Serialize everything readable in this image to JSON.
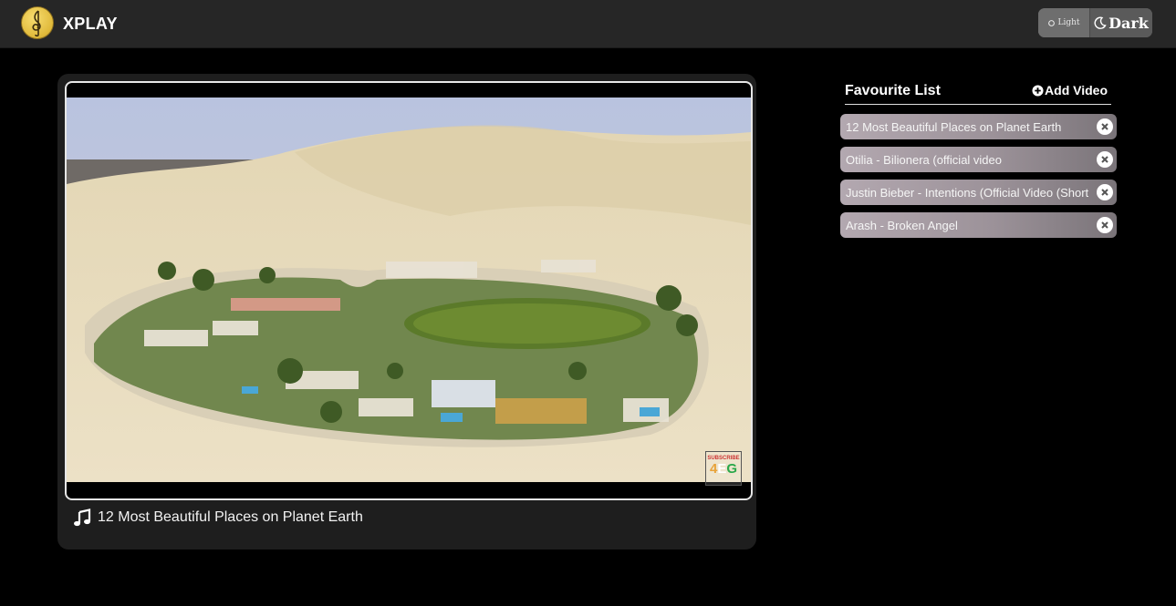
{
  "app": {
    "brand": "XPLAY",
    "logo_icon": "treble-clef-icon"
  },
  "theme_toggle": {
    "light_label": "Light",
    "dark_label": "Dark",
    "selected": "Dark"
  },
  "player": {
    "now_playing_title": "12 Most Beautiful Places on Planet Earth",
    "watermark_top": "SUBSCRIBE",
    "watermark_main_a": "4",
    "watermark_main_b": "E",
    "watermark_main_c": "G"
  },
  "favourites": {
    "title": "Favourite List",
    "add_label": "Add Video",
    "items": [
      {
        "label": "12 Most Beautiful Places on Planet Earth"
      },
      {
        "label": "Otilia - Bilionera (official video"
      },
      {
        "label": "Justin Bieber - Intentions (Official Video (Short"
      },
      {
        "label": "Arash - Broken Angel"
      }
    ]
  },
  "colors": {
    "accent_bg": "#262626",
    "card_bg": "#1e1e1e",
    "list_item": "#a59ba2"
  }
}
